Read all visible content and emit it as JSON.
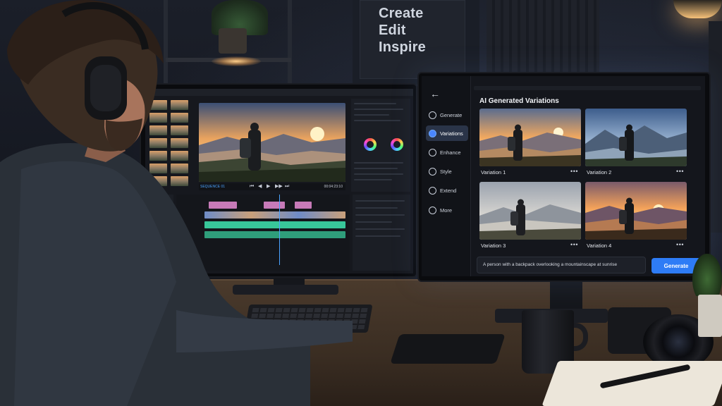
{
  "poster": {
    "text": "Create\nEdit\nInspire"
  },
  "left_editor": {
    "sequence_badge": "SEQUENCE 01",
    "timecode": "00:04:23:10",
    "controls": [
      "⏮",
      "◀",
      "▶",
      "▶▶",
      "⏭"
    ]
  },
  "ai_app": {
    "title": "AI Generated Variations",
    "nav": [
      {
        "label": "Generate",
        "icon": "sparkle-icon",
        "active": false
      },
      {
        "label": "Variations",
        "icon": "variations-icon",
        "active": true
      },
      {
        "label": "Enhance",
        "icon": "enhance-icon",
        "active": false
      },
      {
        "label": "Style",
        "icon": "palette-icon",
        "active": false
      },
      {
        "label": "Extend",
        "icon": "extend-icon",
        "active": false
      },
      {
        "label": "More",
        "icon": "more-icon",
        "active": false
      }
    ],
    "variations": [
      {
        "label": "Variation 1",
        "more": "•••"
      },
      {
        "label": "Variation 2",
        "more": "•••"
      },
      {
        "label": "Variation 3",
        "more": "•••"
      },
      {
        "label": "Variation 4",
        "more": "•••"
      }
    ],
    "prompt": "A person with a backpack overlooking a mountainscape at sunrise",
    "generate_label": "Generate"
  },
  "colors": {
    "accent": "#2e7cf6",
    "active_nav": "#2a3448",
    "desk": "#4a3a2c"
  }
}
